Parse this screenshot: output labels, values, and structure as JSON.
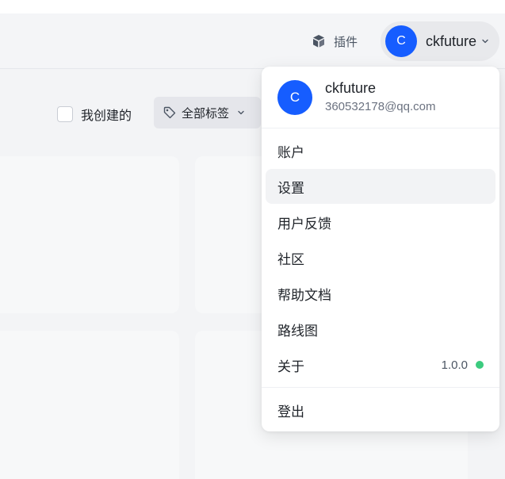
{
  "header": {
    "plugin_label": "插件",
    "user": {
      "avatar_letter": "C",
      "name": "ckfuture"
    }
  },
  "filters": {
    "mine_label": "我创建的",
    "mine_checked": false,
    "tags_label": "全部标签"
  },
  "user_menu": {
    "avatar_letter": "C",
    "name": "ckfuture",
    "email": "360532178@qq.com",
    "items": [
      {
        "label": "账户"
      },
      {
        "label": "设置",
        "hovered": true
      },
      {
        "label": "用户反馈"
      },
      {
        "label": "社区"
      },
      {
        "label": "帮助文档"
      },
      {
        "label": "路线图"
      },
      {
        "label": "关于",
        "version": "1.0.0"
      }
    ],
    "logout_label": "登出"
  },
  "colors": {
    "accent": "#165dff",
    "status_dot": "#3ccb7f"
  },
  "icons": [
    "plugin-cube-icon",
    "chevron-down-icon",
    "tag-icon"
  ]
}
